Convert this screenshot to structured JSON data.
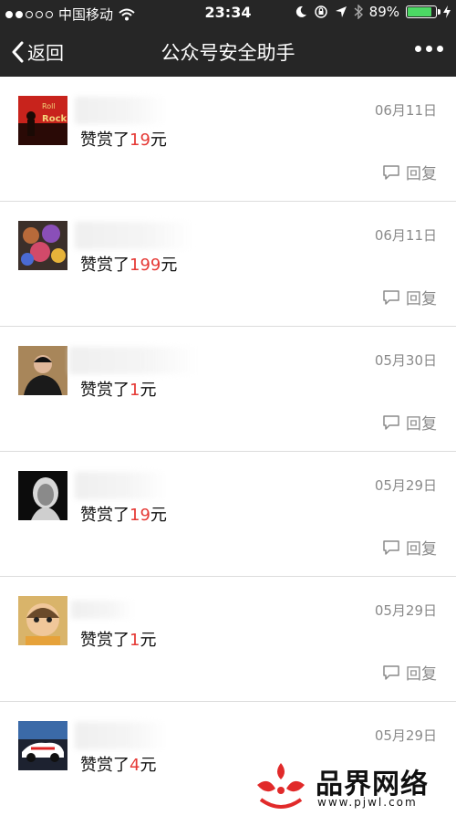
{
  "status_bar": {
    "carrier": "中国移动",
    "time": "23:34",
    "battery": "89%",
    "battery_level": 0.89
  },
  "nav": {
    "back_label": "返回",
    "title": "公众号安全助手"
  },
  "reply_label": "回复",
  "items": [
    {
      "date": "06月11日",
      "prefix": "赞赏了",
      "amount": "19",
      "unit": "元",
      "avatar": "poster-avatar"
    },
    {
      "date": "06月11日",
      "prefix": "赞赏了",
      "amount": "199",
      "unit": "元",
      "avatar": "toys-avatar"
    },
    {
      "date": "05月30日",
      "prefix": "赞赏了",
      "amount": "1",
      "unit": "元",
      "avatar": "man-avatar"
    },
    {
      "date": "05月29日",
      "prefix": "赞赏了",
      "amount": "19",
      "unit": "元",
      "avatar": "portrait-avatar"
    },
    {
      "date": "05月29日",
      "prefix": "赞赏了",
      "amount": "1",
      "unit": "元",
      "avatar": "cartoon-avatar"
    },
    {
      "date": "05月29日",
      "prefix": "赞赏了",
      "amount": "4",
      "unit": "元",
      "avatar": "car-avatar"
    }
  ],
  "watermark": {
    "text": "品界网络",
    "url": "www.pjwl.com"
  }
}
